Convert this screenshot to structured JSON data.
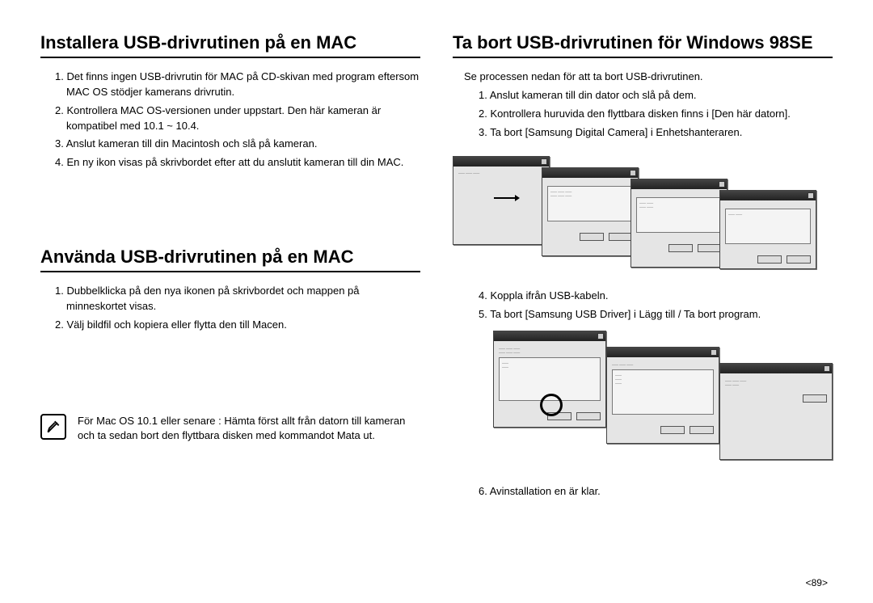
{
  "left": {
    "section1": {
      "title": "Installera USB-drivrutinen på en MAC",
      "items": [
        "1. Det finns ingen USB-drivrutin för MAC på CD-skivan med program eftersom MAC OS stödjer kamerans drivrutin.",
        "2. Kontrollera MAC OS-versionen under uppstart. Den här kameran är kompatibel med 10.1 ~ 10.4.",
        "3. Anslut kameran till din Macintosh och slå på kameran.",
        "4. En ny ikon visas på skrivbordet efter att du anslutit kameran till din MAC."
      ]
    },
    "section2": {
      "title": "Använda USB-drivrutinen på en MAC",
      "items": [
        "1. Dubbelklicka på den nya ikonen på skrivbordet och mappen på minneskortet visas.",
        "2. Välj bildfil och kopiera eller flytta den till Macen."
      ]
    },
    "note": "För Mac OS 10.1 eller senare : Hämta först allt från datorn till kameran och ta sedan bort den flyttbara disken med kommandot Mata ut."
  },
  "right": {
    "section1": {
      "title": "Ta bort USB-drivrutinen för Windows 98SE",
      "intro": "Se processen nedan för att ta bort USB-drivrutinen.",
      "items1": [
        "1. Anslut kameran till din dator och slå på dem.",
        "2. Kontrollera huruvida den flyttbara disken finns i [Den här datorn].",
        "3. Ta bort [Samsung Digital Camera] i Enhetshanteraren."
      ],
      "items2": [
        "4. Koppla ifrån USB-kabeln.",
        "5. Ta bort [Samsung USB Driver] i Lägg till / Ta bort program."
      ],
      "items3": [
        "6. Avinstallation en är klar."
      ]
    }
  },
  "pagenum": "<89>"
}
